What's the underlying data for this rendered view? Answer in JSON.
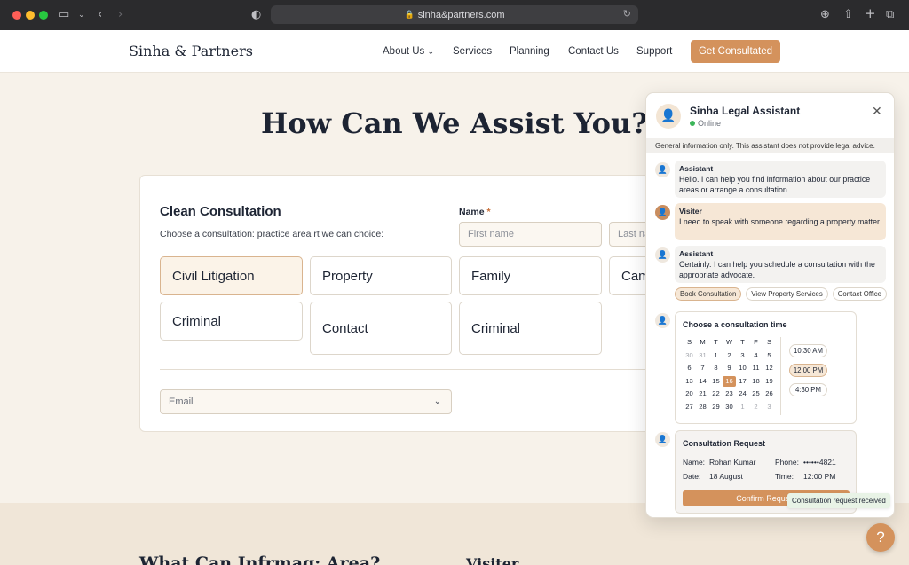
{
  "browser": {
    "url": "sinha&partners.com"
  },
  "site": {
    "logo": "Sinha & Partners",
    "nav": [
      "About Us",
      "Services",
      "Planning",
      "Contact Us",
      "Support"
    ],
    "cta": "Get Consultated"
  },
  "main": {
    "heading": "How Can We Assist You?",
    "form": {
      "title": "Clean Consultation",
      "subtitle": "Choose a consultation: practice area rt we can choice:",
      "name_label": "Name",
      "name_required": "*",
      "first_placeholder": "First name",
      "last_placeholder": "Last name",
      "tiles": [
        "Civil Litigation",
        "Property",
        "Family",
        "Camp",
        "Criminal",
        "Contact",
        "Criminal"
      ],
      "email_placeholder": "Email"
    },
    "bottom_heading": "What Can Infrmag: Area?",
    "bottom_right": "Visiter"
  },
  "chat": {
    "title": "Sinha Legal Assistant",
    "status": "Online",
    "disclaimer": "General information only. This assistant does not provide legal advice.",
    "messages": [
      {
        "sender": "Assistant",
        "text": "Hello. I can help you find information about our practice areas or arrange a consultation."
      },
      {
        "sender": "Visiter",
        "text": "I need to speak with someone regarding a property matter."
      },
      {
        "sender": "Assistant",
        "text": "Certainly. I can help you schedule a consultation with the appropriate advocate."
      }
    ],
    "chips": [
      "Book Consultation",
      "View Property Services",
      "Contact Office"
    ],
    "calendar": {
      "title": "Choose a consultation time",
      "weekdays": [
        "S",
        "M",
        "T",
        "W",
        "T",
        "F",
        "S"
      ],
      "days": [
        "30",
        "31",
        "1",
        "2",
        "3",
        "4",
        "5",
        "6",
        "7",
        "8",
        "9",
        "10",
        "11",
        "12",
        "13",
        "14",
        "15",
        "16",
        "17",
        "18",
        "19",
        "20",
        "21",
        "22",
        "23",
        "24",
        "25",
        "26",
        "27",
        "28",
        "29",
        "30",
        "1",
        "2",
        "3"
      ],
      "selected_day": "16",
      "times": [
        "10:30 AM",
        "12:00 PM",
        "4:30 PM"
      ],
      "selected_time": "12:00 PM"
    },
    "request": {
      "title": "Consultation Request",
      "name_label": "Name:",
      "name": "Rohan Kumar",
      "phone_label": "Phone:",
      "phone": "••••••4821",
      "date_label": "Date:",
      "date": "18 August",
      "time_label": "Time:",
      "time": "12:00 PM",
      "confirm": "Confirm Request"
    },
    "toast": "Consultation request received"
  },
  "help": "?"
}
